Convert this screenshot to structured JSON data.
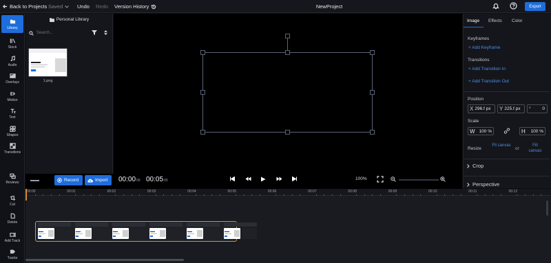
{
  "topbar": {
    "back_label": "Back to Projects",
    "saved_label": "Saved",
    "undo_label": "Undo",
    "redo_label": "Redo",
    "version_history_label": "Version History",
    "project_name": "NewProject",
    "export_label": "Export"
  },
  "rail": {
    "items": [
      {
        "label": "Library",
        "icon": "library-icon",
        "active": true
      },
      {
        "label": "Stock",
        "icon": "stock-icon"
      },
      {
        "label": "Audio",
        "icon": "audio-icon"
      },
      {
        "label": "Overlays",
        "icon": "overlays-icon"
      },
      {
        "label": "Motion",
        "icon": "motion-icon"
      },
      {
        "label": "Text",
        "icon": "text-icon"
      },
      {
        "label": "Shapes",
        "icon": "shapes-icon"
      },
      {
        "label": "Transitions",
        "icon": "transitions-icon"
      },
      {
        "label": "Reviews",
        "icon": "reviews-icon"
      },
      {
        "label": "Cut",
        "icon": "cut-icon"
      },
      {
        "label": "Delete",
        "icon": "delete-icon"
      },
      {
        "label": "Add Track",
        "icon": "add-track-icon"
      },
      {
        "label": "Tracks",
        "icon": "tracks-icon"
      }
    ]
  },
  "library": {
    "title": "Personal Library",
    "search_placeholder": "Search...",
    "items": [
      {
        "caption": "1.png"
      }
    ]
  },
  "controls": {
    "record_label": "Record",
    "import_label": "Import",
    "current_time": "00:00",
    "current_frames": "00",
    "duration_time": "00:05",
    "duration_frames": "00",
    "zoom_level": "100%"
  },
  "right_panel": {
    "tabs": [
      "Image",
      "Effects",
      "Color"
    ],
    "active_tab": "Image",
    "keyframes_label": "Keyframes",
    "add_keyframe": "+ Add Keyframe",
    "transitions_label": "Transitions",
    "add_transition_in": "+ Add Transition In",
    "add_transition_out": "+ Add Transition Out",
    "position_label": "Position",
    "pos_x_key": "X",
    "pos_x": "296.f px",
    "pos_y_key": "Y",
    "pos_y": "225.f px",
    "rotation_unit": "°",
    "rotation": "0",
    "scale_label": "Scale",
    "scale_w_key": "W",
    "scale_w": "100 %",
    "scale_h_key": "H",
    "scale_h": "100 %",
    "resize_label": "Resize",
    "fit_canvas": "Fit canvas",
    "or_label": "or",
    "fill_canvas": "Fill canvas",
    "crop_label": "Crop",
    "perspective_label": "Perspective"
  },
  "timeline": {
    "ticks": [
      "00:00",
      "00:01",
      "00:02",
      "00:03",
      "00:04",
      "00:05",
      "00:06",
      "00:07",
      "00:08",
      "00:09",
      "00:10",
      "00:11",
      "00:12"
    ],
    "clip_thumbnails": 6
  },
  "colors": {
    "accent": "#1e6ddc",
    "clip_border": "#d8952e",
    "background": "#0d0e12"
  }
}
